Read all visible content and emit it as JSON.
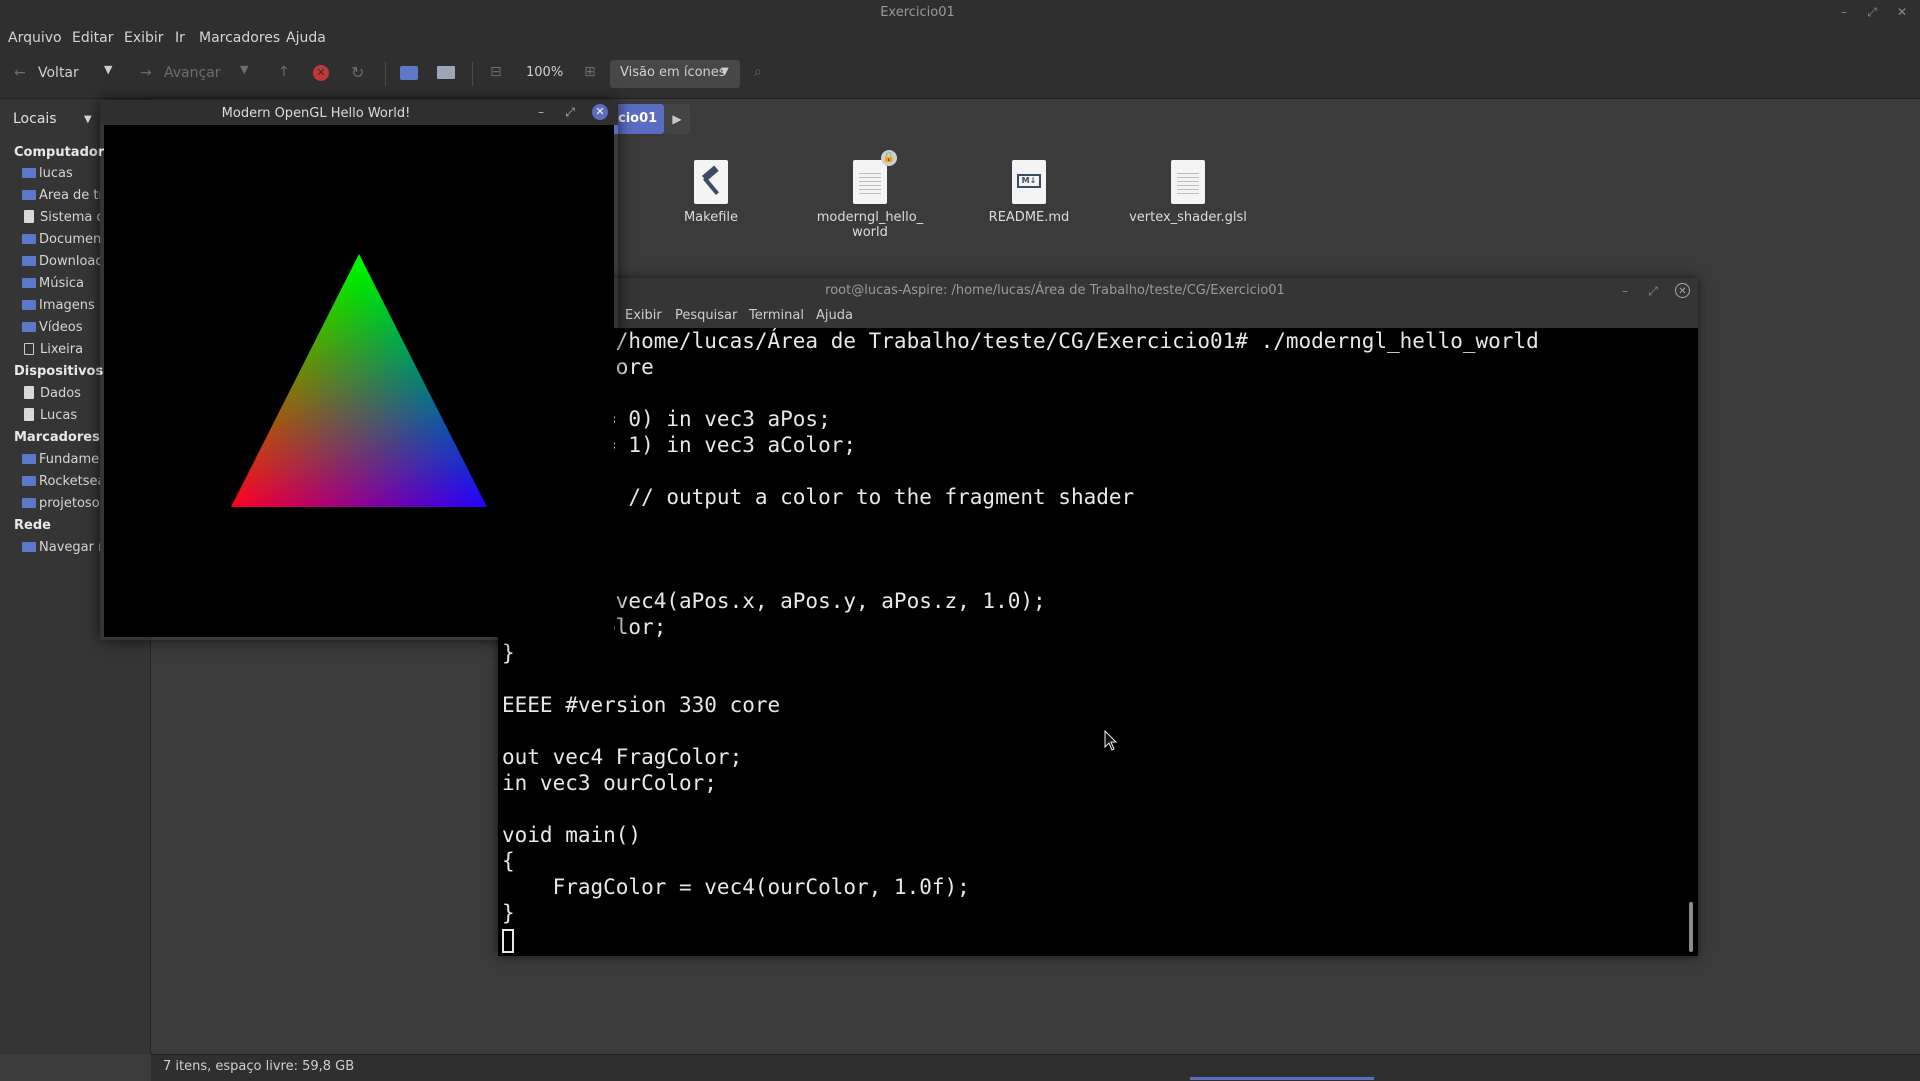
{
  "file_manager": {
    "title": "Exercicio01",
    "menu": [
      "Arquivo",
      "Editar",
      "Exibir",
      "Ir",
      "Marcadores",
      "Ajuda"
    ],
    "toolbar": {
      "back_label": "Voltar",
      "forward_label": "Avançar",
      "zoom": "100%",
      "view_mode": "Visão em ícones"
    },
    "sidebar": {
      "places_selector": "Locais",
      "computer_header": "Computador",
      "computer_items": [
        "lucas",
        "Área de trabalho",
        "Sistema de arquivos",
        "Documentos",
        "Downloads",
        "Música",
        "Imagens",
        "Vídeos",
        "Lixeira"
      ],
      "devices_header": "Dispositivos",
      "devices_items": [
        "Dados",
        "Lucas"
      ],
      "bookmarks_header": "Marcadores",
      "bookmarks_items": [
        "Fundamentos",
        "Rocketseat",
        "projetoso"
      ],
      "network_header": "Rede",
      "network_items": [
        "Navegar na rede"
      ]
    },
    "path_current": "cio01",
    "files": [
      {
        "name": "Makefile",
        "icon": "hammer-icon"
      },
      {
        "name": "moderngl_hello_world",
        "icon": "text-file-locked-icon"
      },
      {
        "name": "README.md",
        "icon": "markdown-file-icon"
      },
      {
        "name": "vertex_shader.glsl",
        "icon": "text-file-icon"
      }
    ],
    "status": "7 itens, espaço livre: 59,8 GB"
  },
  "terminal": {
    "title": "root@lucas-Aspire: /home/lucas/Área de Trabalho/teste/CG/Exercicio01",
    "menu": [
      "Exibir",
      "Pesquisar",
      "Terminal",
      "Ajuda"
    ],
    "lines": [
      "s-Aspire:/home/lucas/Área de Trabalho/teste/CG/Exercicio01# ./moderngl_hello_world",
      "ion 330 core",
      "",
      "ocation = 0) in vec3 aPos;",
      "ocation = 1) in vec3 aColor;",
      "",
      "ourColor; // output a color to the fragment shader",
      "",
      "()",
      "",
      "sition = vec4(aPos.x, aPos.y, aPos.z, 1.0);",
      "lor = aColor;",
      "}",
      "",
      "EEEE #version 330 core",
      "",
      "out vec4 FragColor;",
      "in vec3 ourColor;",
      "",
      "void main()",
      "{",
      "    FragColor = vec4(ourColor, 1.0f);",
      "}"
    ]
  },
  "opengl_window": {
    "title": "Modern OpenGL Hello World!",
    "triangle_colors": {
      "top": "#00ff00",
      "left": "#ff0000",
      "right": "#0000ff"
    }
  }
}
